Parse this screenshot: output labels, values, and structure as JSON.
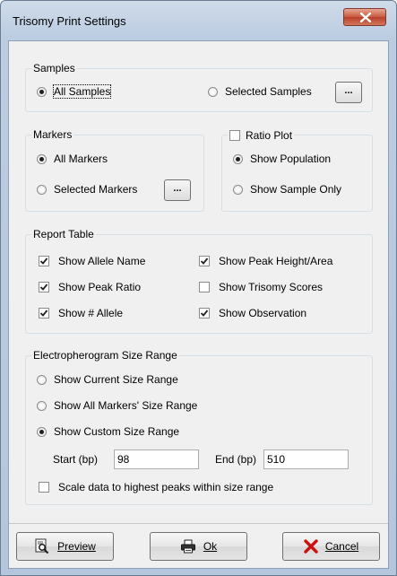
{
  "window": {
    "title": "Trisomy Print Settings",
    "close_glyph": "x"
  },
  "samples": {
    "legend": "Samples",
    "options": [
      {
        "label": "All Samples",
        "selected": true
      },
      {
        "label": "Selected Samples",
        "selected": false
      }
    ],
    "browse_label": "..."
  },
  "markers": {
    "legend": "Markers",
    "options": [
      {
        "label": "All Markers",
        "selected": true
      },
      {
        "label": "Selected Markers",
        "selected": false
      }
    ],
    "browse_label": "..."
  },
  "ratio_plot": {
    "legend": "Ratio Plot",
    "checked": false,
    "options": [
      {
        "label": "Show Population",
        "selected": true
      },
      {
        "label": "Show Sample Only",
        "selected": false
      }
    ]
  },
  "report_table": {
    "legend": "Report Table",
    "items": [
      {
        "label": "Show Allele Name",
        "checked": true
      },
      {
        "label": "Show Peak Height/Area",
        "checked": true
      },
      {
        "label": "Show Peak Ratio",
        "checked": true
      },
      {
        "label": "Show Trisomy Scores",
        "checked": false
      },
      {
        "label": "Show # Allele",
        "checked": true
      },
      {
        "label": "Show Observation",
        "checked": true
      }
    ]
  },
  "size_range": {
    "legend": "Electropherogram Size Range",
    "options": [
      {
        "label": "Show Current Size Range",
        "selected": false
      },
      {
        "label": "Show All Markers' Size Range",
        "selected": false
      },
      {
        "label": "Show Custom Size Range",
        "selected": true
      }
    ],
    "start_label": "Start (bp)",
    "start_value": "98",
    "end_label": "End (bp)",
    "end_value": "510",
    "scale_label": "Scale data to highest peaks within size range",
    "scale_checked": false
  },
  "buttons": {
    "preview_label": "Preview",
    "ok_label": "Ok",
    "cancel_label": "Cancel"
  },
  "icons": {
    "close": "close-x-icon",
    "preview": "magnifier-page-icon",
    "ok": "printer-icon",
    "cancel": "red-x-icon"
  },
  "colors": {
    "cancel_x": "#cc1111",
    "close_btn": "#c75a3e"
  }
}
